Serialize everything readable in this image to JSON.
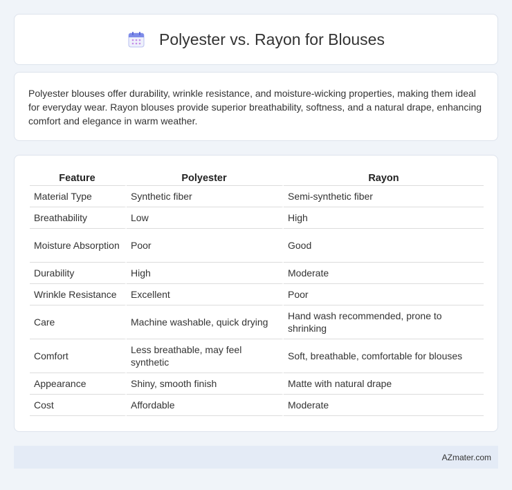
{
  "header": {
    "title": "Polyester vs. Rayon for Blouses",
    "icon": "calendar-icon"
  },
  "summary": "Polyester blouses offer durability, wrinkle resistance, and moisture-wicking properties, making them ideal for everyday wear. Rayon blouses provide superior breathability, softness, and a natural drape, enhancing comfort and elegance in warm weather.",
  "table": {
    "headers": [
      "Feature",
      "Polyester",
      "Rayon"
    ],
    "rows": [
      [
        "Material Type",
        "Synthetic fiber",
        "Semi-synthetic fiber"
      ],
      [
        "Breathability",
        "Low",
        "High"
      ],
      [
        "Moisture Absorption",
        "Poor",
        "Good"
      ],
      [
        "Durability",
        "High",
        "Moderate"
      ],
      [
        "Wrinkle Resistance",
        "Excellent",
        "Poor"
      ],
      [
        "Care",
        "Machine washable, quick drying",
        "Hand wash recommended, prone to shrinking"
      ],
      [
        "Comfort",
        "Less breathable, may feel synthetic",
        "Soft, breathable, comfortable for blouses"
      ],
      [
        "Appearance",
        "Shiny, smooth finish",
        "Matte with natural drape"
      ],
      [
        "Cost",
        "Affordable",
        "Moderate"
      ]
    ]
  },
  "footer": {
    "brand": "AZmater.com"
  }
}
